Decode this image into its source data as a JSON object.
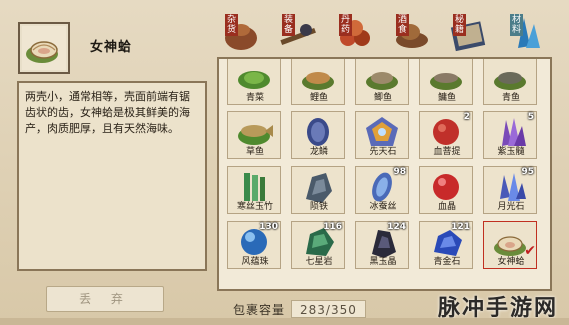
{
  "item": {
    "name": "女神蛤",
    "description": "两壳小，通常相等，壳面前端有锯齿状的齿，女神蛤是极其鲜美的海产，肉质肥厚，且有天然海味。"
  },
  "discard_button": "丢 弃",
  "tabs": [
    {
      "label": "杂货",
      "icon": "sack-icon"
    },
    {
      "label": "装备",
      "icon": "weapon-icon"
    },
    {
      "label": "丹药",
      "icon": "pill-icon"
    },
    {
      "label": "酒食",
      "icon": "food-icon"
    },
    {
      "label": "秘籍",
      "icon": "book-icon"
    },
    {
      "label": "材料",
      "icon": "crystal-icon",
      "active": true
    }
  ],
  "grid": {
    "rows": [
      [
        {
          "name": "青菜",
          "count": "",
          "icon": "greens-icon"
        },
        {
          "name": "鲤鱼",
          "count": "",
          "icon": "carp-icon"
        },
        {
          "name": "鲫鱼",
          "count": "",
          "icon": "crucian-icon"
        },
        {
          "name": "鳙鱼",
          "count": "",
          "icon": "bighead-icon"
        },
        {
          "name": "青鱼",
          "count": "",
          "icon": "blackcarp-icon"
        }
      ],
      [
        {
          "name": "草鱼",
          "count": "",
          "icon": "grass-carp-icon"
        },
        {
          "name": "龙鳞",
          "count": "",
          "icon": "dragon-scale-icon"
        },
        {
          "name": "先天石",
          "count": "",
          "icon": "innate-stone-icon"
        },
        {
          "name": "血菩提",
          "count": "2",
          "icon": "blood-bodhi-icon"
        },
        {
          "name": "紫玉髓",
          "count": "5",
          "icon": "purple-jade-icon"
        }
      ],
      [
        {
          "name": "寒丝玉竹",
          "count": "",
          "icon": "jade-bamboo-icon"
        },
        {
          "name": "陨铁",
          "count": "",
          "icon": "meteor-iron-icon"
        },
        {
          "name": "冰蚕丝",
          "count": "98",
          "icon": "ice-silk-icon"
        },
        {
          "name": "血晶",
          "count": "",
          "icon": "blood-crystal-icon"
        },
        {
          "name": "月光石",
          "count": "95",
          "icon": "moonstone-icon"
        }
      ],
      [
        {
          "name": "风蕴珠",
          "count": "130",
          "icon": "wind-pearl-icon"
        },
        {
          "name": "七星岩",
          "count": "116",
          "icon": "seven-star-rock-icon"
        },
        {
          "name": "黑玉晶",
          "count": "124",
          "icon": "black-jade-icon"
        },
        {
          "name": "青金石",
          "count": "121",
          "icon": "lapis-icon"
        },
        {
          "name": "女神蛤",
          "count": "",
          "icon": "goddess-clam-icon",
          "selected": true
        }
      ]
    ]
  },
  "capacity": {
    "label": "包裹容量",
    "value": "283/350"
  },
  "watermark": "脉冲手游网",
  "colors": {
    "tab_label_red": "#9a2e1f",
    "tab_label_active": "#4b7d8a",
    "panel_bg": "#f2ead8",
    "border": "#8a7658"
  }
}
